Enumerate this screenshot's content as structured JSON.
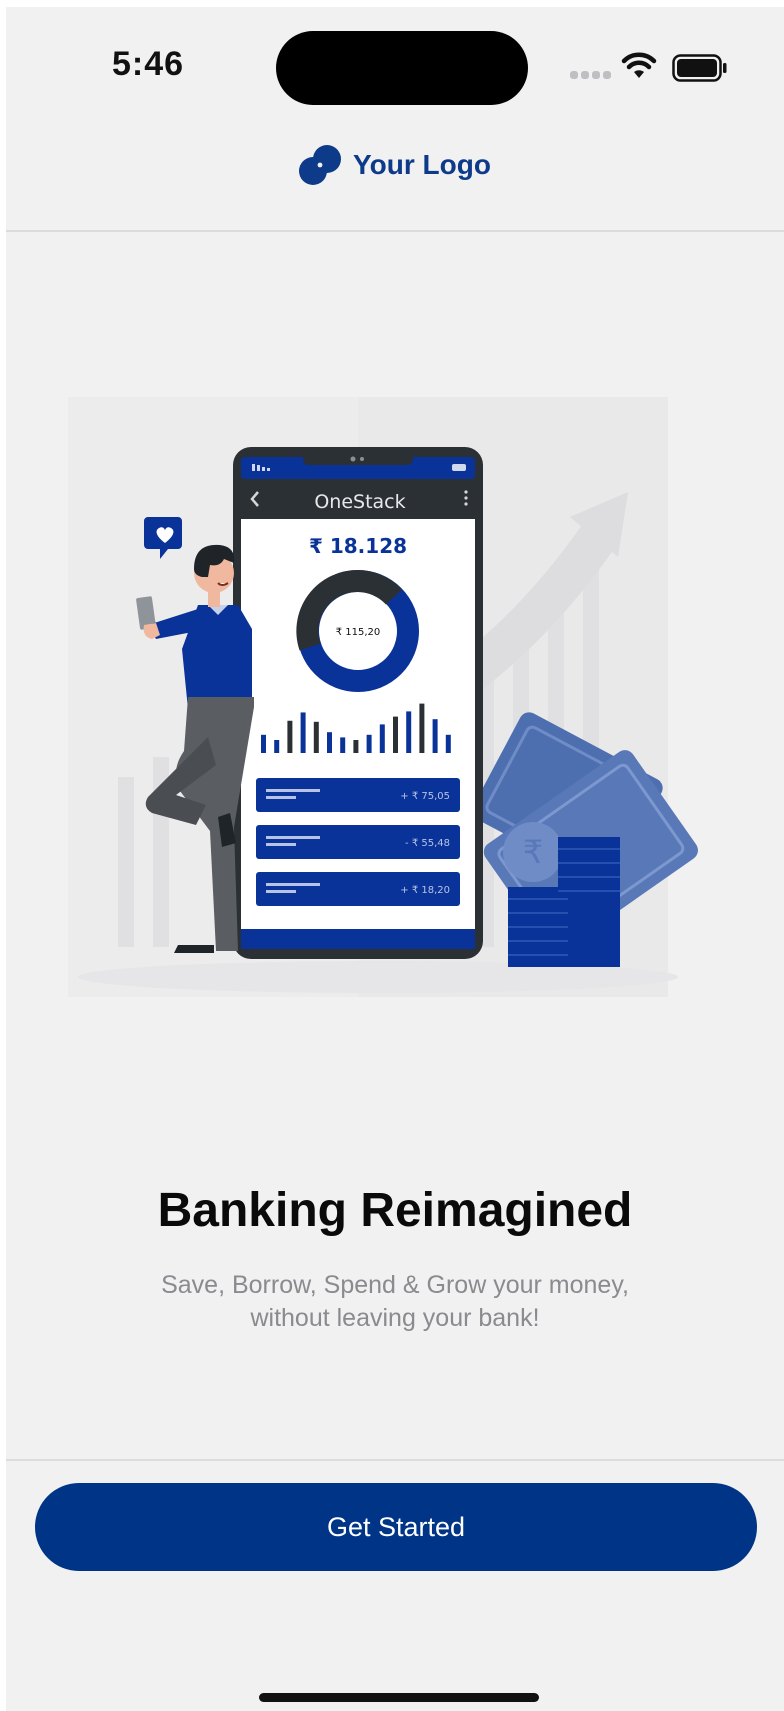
{
  "status_bar": {
    "time": "5:46"
  },
  "header": {
    "logo_text": "Your Logo"
  },
  "illustration": {
    "app_name": "OneStack",
    "balance": "₹ 18.128",
    "donut_value": "₹ 115,20",
    "transactions": [
      {
        "amount": "+ ₹ 75,05"
      },
      {
        "amount": "- ₹ 55,48"
      },
      {
        "amount": "+ ₹ 18,20"
      }
    ],
    "bar_levels": [
      0.35,
      0.25,
      0.62,
      0.78,
      0.6,
      0.4,
      0.3,
      0.25,
      0.35,
      0.55,
      0.7,
      0.8,
      0.95,
      0.65,
      0.35
    ],
    "bar_dark": [
      false,
      false,
      true,
      false,
      true,
      false,
      false,
      true,
      false,
      false,
      true,
      false,
      true,
      false,
      false
    ]
  },
  "content": {
    "headline": "Banking Reimagined",
    "subtitle_line1": "Save, Borrow, Spend & Grow your money,",
    "subtitle_line2": "without leaving your bank!"
  },
  "footer": {
    "cta_label": "Get Started"
  },
  "colors": {
    "brand": "#003487",
    "illustration_blue": "#0a3399",
    "background": "#f1f1f2"
  }
}
